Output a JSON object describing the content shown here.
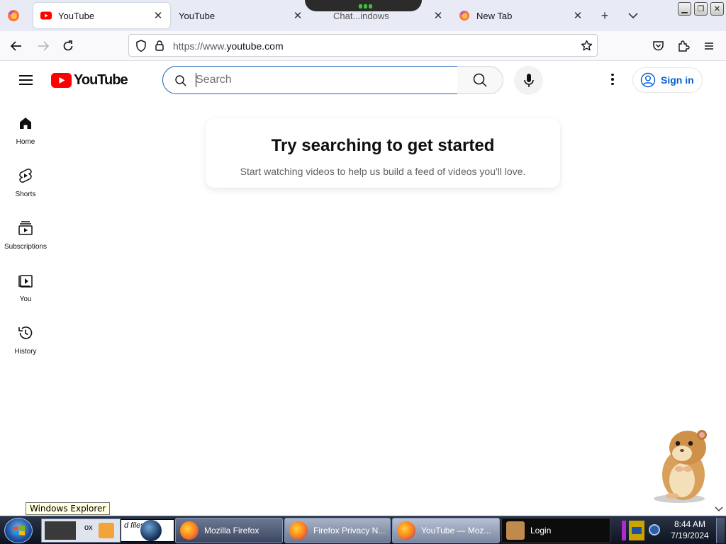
{
  "browser": {
    "tabs": [
      {
        "label": "YouTube",
        "active": true,
        "icon": "youtube-favicon"
      },
      {
        "label": "YouTube",
        "active": false,
        "icon": "none"
      },
      {
        "label": "Chat...indows",
        "active": false,
        "icon": "firefox-favicon"
      },
      {
        "label": "New Tab",
        "active": false,
        "icon": "firefox-favicon"
      }
    ],
    "url_prefix": "https://www.",
    "url_host": "youtube.com"
  },
  "youtube": {
    "logo_text": "YouTube",
    "search_placeholder": "Search",
    "signin_label": "Sign in",
    "guide": [
      {
        "label": "Home",
        "icon": "home-icon"
      },
      {
        "label": "Shorts",
        "icon": "shorts-icon"
      },
      {
        "label": "Subscriptions",
        "icon": "subscriptions-icon"
      },
      {
        "label": "You",
        "icon": "you-icon"
      },
      {
        "label": "History",
        "icon": "history-icon"
      }
    ],
    "prompt_title": "Try searching to get started",
    "prompt_subtitle": "Start watching videos to help us build a feed of videos you'll love."
  },
  "os": {
    "tooltip": "Windows Explorer",
    "taskbar_items": [
      {
        "label": "Mozilla Firefox"
      },
      {
        "label": "Firefox Privacy N..."
      },
      {
        "label": "YouTube — Moz..."
      },
      {
        "label": "Login"
      }
    ],
    "quicklaunch_text": [
      "ox",
      "d files"
    ],
    "clock_time": "8:44 AM",
    "clock_date": "7/19/2024"
  },
  "colors": {
    "youtube_red": "#ff0000",
    "link_blue": "#065fd4",
    "search_focus": "#1c62b9"
  }
}
